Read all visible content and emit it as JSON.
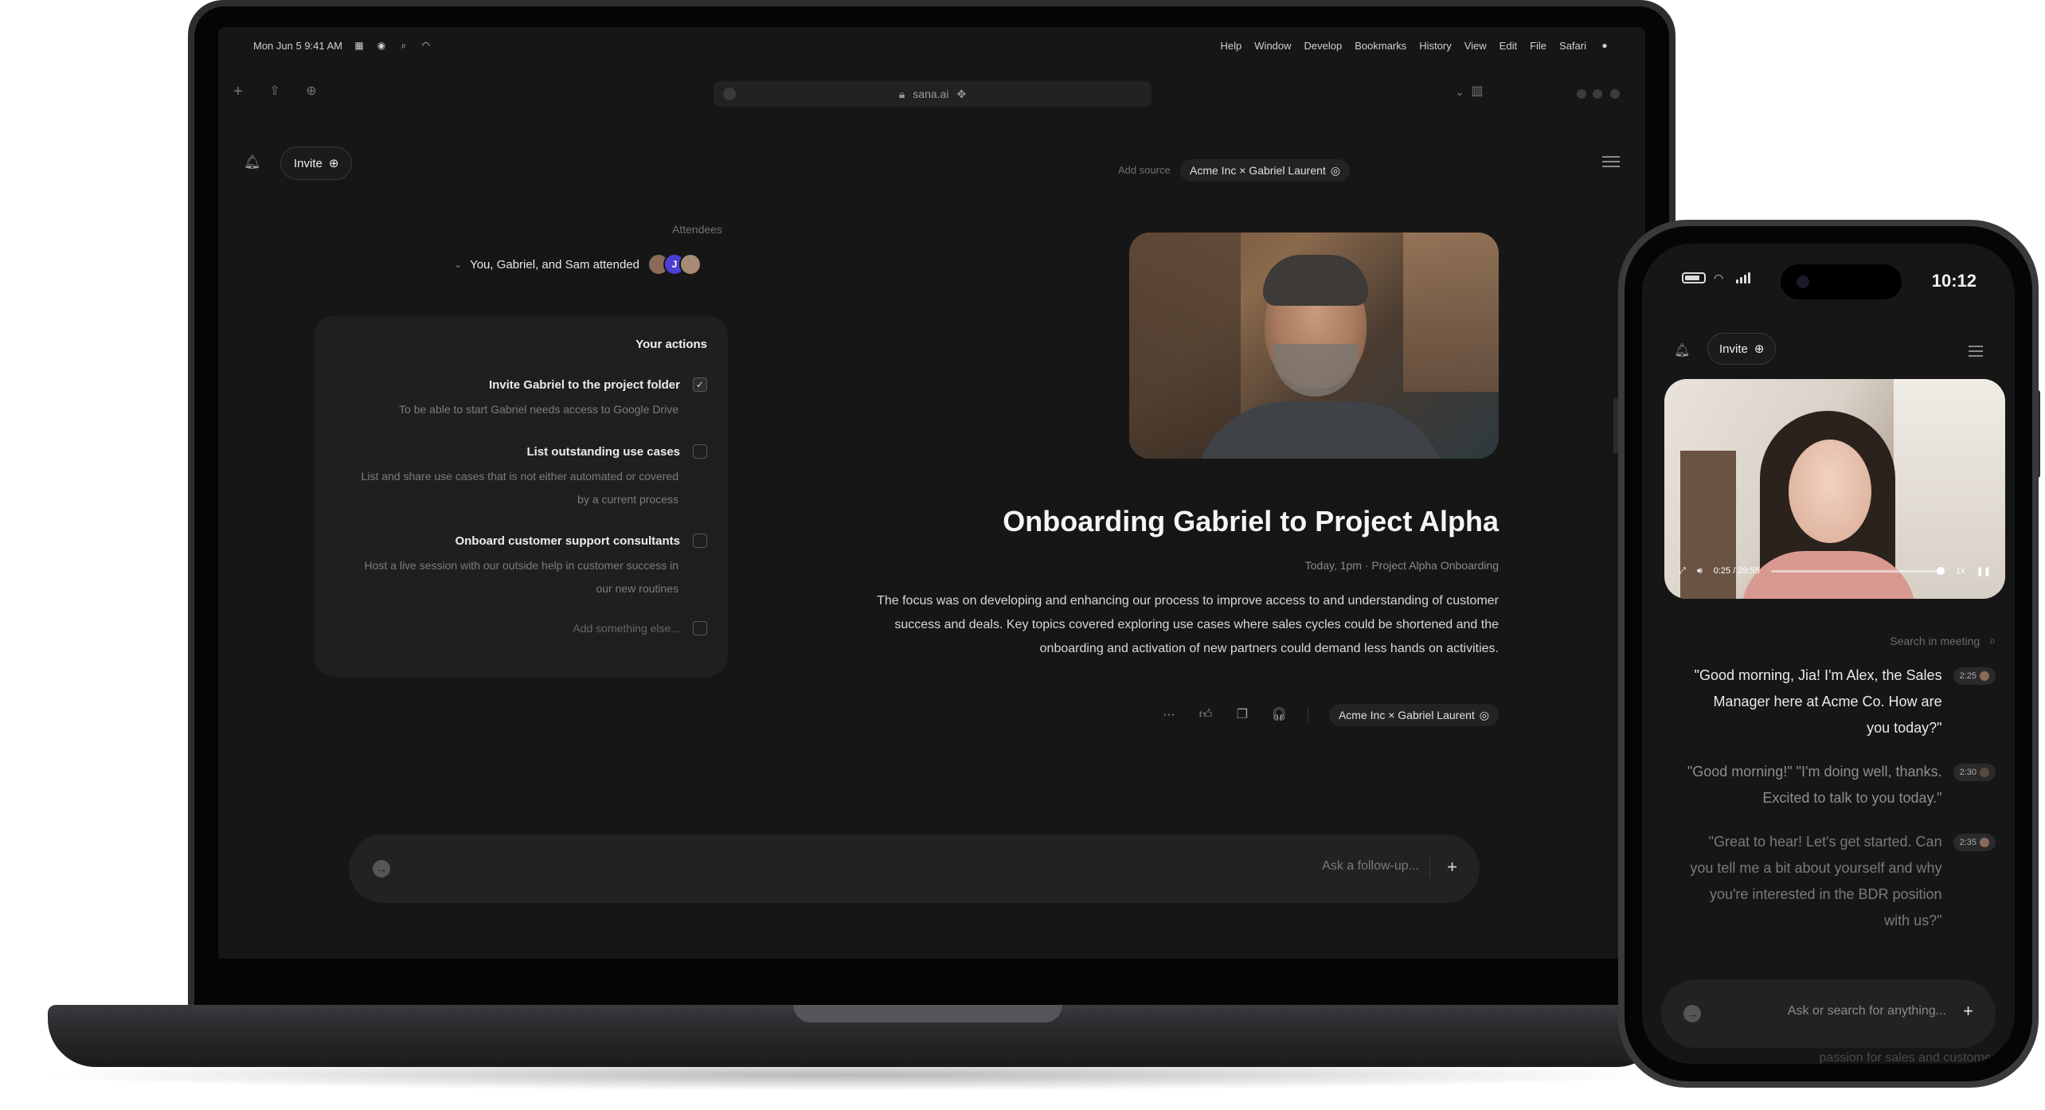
{
  "laptop": {
    "menubar": {
      "apple": "",
      "items": [
        "Safari",
        "File",
        "Edit",
        "View",
        "History",
        "Bookmarks",
        "Develop",
        "Window",
        "Help"
      ],
      "clock": "Mon Jun 5  9:41 AM"
    },
    "browser": {
      "url": "sana.ai"
    },
    "header": {
      "invite_label": "Invite",
      "source_chip": "Acme Inc × Gabriel Laurent",
      "add_source": "Add source"
    },
    "attendees": {
      "label": "Attendees",
      "summary": "You, Gabriel, and Sam attended",
      "avatar_initial": "J"
    },
    "actions": {
      "title": "Your actions",
      "items": [
        {
          "title": "Invite Gabriel to the project folder",
          "desc": "To be able to start Gabriel needs access to Google Drive",
          "done": true
        },
        {
          "title": "List outstanding use cases",
          "desc": "List and share use cases that is not either automated or covered by a current process",
          "done": false
        },
        {
          "title": "Onboard customer support consultants",
          "desc": "Host a live session with our outside help in customer success in our new routines",
          "done": false
        }
      ],
      "add_placeholder": "Add something else..."
    },
    "meeting": {
      "title": "Onboarding Gabriel to Project Alpha",
      "meta_project": "Project Alpha Onboarding",
      "meta_time": "Today, 1pm",
      "body": "The focus was on developing and enhancing our process to improve access to and understanding of customer success and deals. Key topics covered exploring use cases where sales cycles could be shortened and the onboarding and activation of new partners could demand less hands on activities.",
      "chip": "Acme Inc × Gabriel Laurent",
      "more": "···"
    },
    "followup": {
      "placeholder": "Ask a follow-up...",
      "plus": "+"
    }
  },
  "phone": {
    "time": "10:12",
    "invite_label": "Invite",
    "video": {
      "time_readout": "0:25 / 29:55",
      "speed": "1x"
    },
    "search_placeholder": "Search in meeting",
    "transcript": [
      {
        "time": "2:25",
        "text": "\"Good morning, Jia! I'm Alex, the Sales Manager here at Acme Co. How are you today?\"",
        "tone": "bright"
      },
      {
        "time": "2:30",
        "text": "\"Good morning!\" \"I'm doing well, thanks. Excited to talk to you today.\"",
        "tone": "dim"
      },
      {
        "time": "2:35",
        "text": "\"Great to hear! Let's get started. Can you tell me a bit about yourself and why you're interested in the BDR position with us?\"",
        "tone": "dimmer"
      }
    ],
    "input_placeholder": "Ask or search for anything...",
    "plus": "+",
    "faded_text": "passion for sales and customer"
  }
}
